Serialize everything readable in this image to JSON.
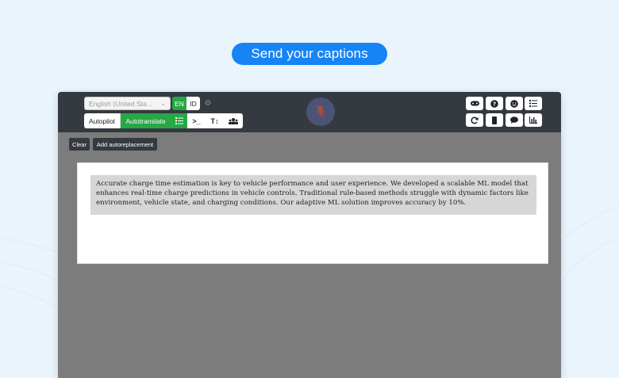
{
  "banner": {
    "label": "Send your captions"
  },
  "toolbar": {
    "language": "English (United Sta...",
    "lang_en": "EN",
    "lang_id": "ID",
    "autopilot": "Autopilot",
    "autotranslate": "Autotranslate"
  },
  "actions": {
    "clear": "Clear",
    "add_autoreplacement": "Add autoreplacement"
  },
  "caption": {
    "text": "Accurate charge time estimation is key to vehicle performance and user experience. We developed a scalable ML model that enhances real-time charge predictions in vehicle controls. Traditional rule-based methods struggle with dynamic factors like environment, vehicle state, and charging conditions. Our adaptive ML solution improves accuracy by 10%."
  },
  "icons": {
    "language_dropdown": "chevron-down-icon",
    "settings": "gear-icon",
    "autotranslate_list": "list-icon",
    "terminal": "terminal-icon",
    "text_size": "text-height-icon",
    "users": "users-icon",
    "microphone": "microphone-icon",
    "gamepad": "gamepad-icon",
    "help": "question-icon",
    "emoji": "smile-icon",
    "list": "list-icon",
    "refresh": "refresh-icon",
    "mobile": "mobile-icon",
    "comment": "comment-icon",
    "chart": "chart-icon"
  },
  "colors": {
    "accent_blue": "#1784f5",
    "active_green": "#28a745",
    "toolbar_dark": "#343a40",
    "background": "#e9f4fd",
    "workspace_gray": "#7c7c7c",
    "mic_off": "#4b5477",
    "mic_icon": "#b44a3c"
  }
}
